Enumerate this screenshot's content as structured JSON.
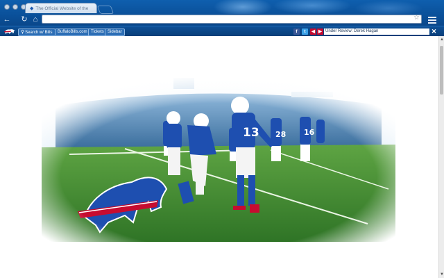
{
  "browser": {
    "tab_title": "The Official Website of the",
    "tab_favicon": "bills-favicon-icon",
    "address_value": "",
    "icons": {
      "back": "back-arrow-icon",
      "reload": "reload-icon",
      "home": "home-icon",
      "star": "star-icon",
      "menu": "menu-icon"
    }
  },
  "extension_bar": {
    "buttons": [
      {
        "label": "Search w/ Bills"
      },
      {
        "label": "BuffaloBills.com"
      },
      {
        "label": "Tickets"
      },
      {
        "label": "Sidebar"
      }
    ],
    "social": [
      {
        "label": "f",
        "icon": "facebook-icon",
        "color": "#3b5998"
      },
      {
        "label": "t",
        "icon": "twitter-icon",
        "color": "#3aa0e6"
      }
    ],
    "ticker_prev_icon": "prev-arrow-icon",
    "ticker_next_icon": "next-arrow-icon",
    "ticker_text": "Under Review: Derek Hagan",
    "close_icon": "close-icon"
  },
  "colors": {
    "chrome_blue": "#0a4f98",
    "bills_blue": "#00338d",
    "bills_red": "#c60c30",
    "turf_green": "#3f8a2e"
  }
}
